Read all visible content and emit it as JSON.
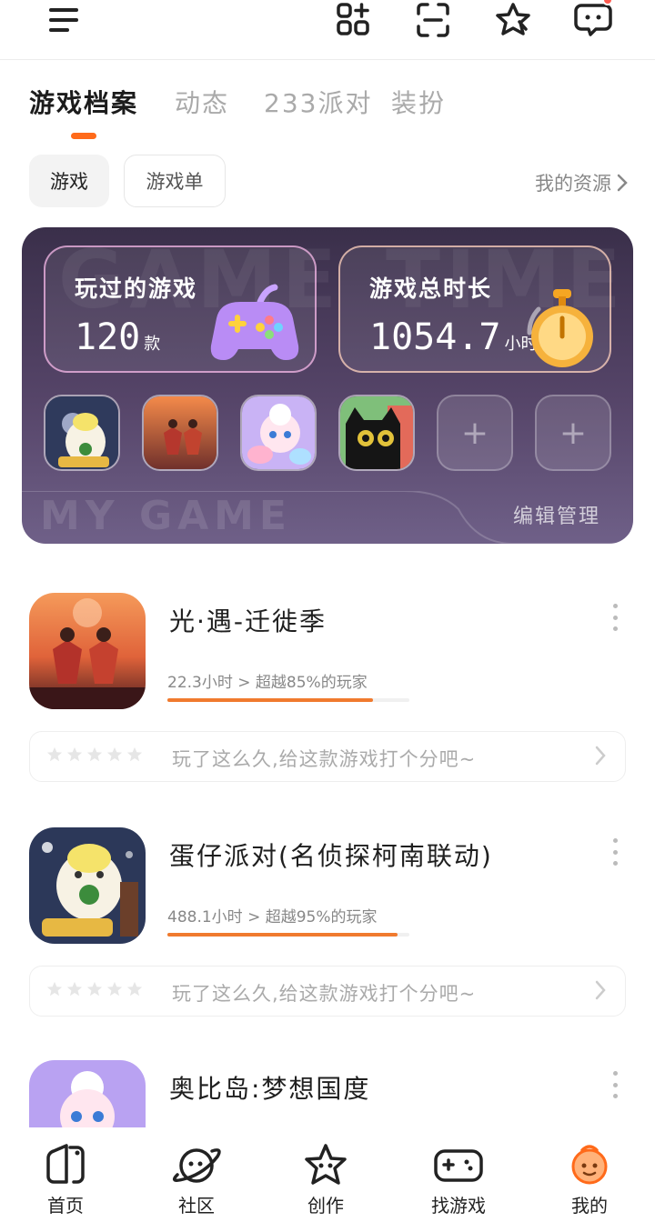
{
  "header": {
    "notification_badge": true
  },
  "tabs": [
    {
      "label": "游戏档案",
      "active": true
    },
    {
      "label": "动态",
      "active": false
    },
    {
      "label": "233派对",
      "active": false
    },
    {
      "label": "装扮",
      "active": false
    }
  ],
  "chips": {
    "game": "游戏",
    "list": "游戏单",
    "my_resources": "我的资源"
  },
  "card": {
    "bg_word_left": "GAME",
    "bg_word_right": "TIME",
    "bg_word_bottom": "MY GAME",
    "played": {
      "label": "玩过的游戏",
      "value": "120",
      "unit": "款"
    },
    "time": {
      "label": "游戏总时长",
      "value": "1054.7",
      "unit": "小时"
    },
    "edit_label": "编辑管理",
    "add_symbol": "+"
  },
  "games": [
    {
      "name": "光·遇-迁徙季",
      "stat": "22.3小时 > 超越85%的玩家",
      "progress": 0.85,
      "rate_prompt": "玩了这么久,给这款游戏打个分吧~"
    },
    {
      "name": "蛋仔派对(名侦探柯南联动)",
      "stat": "488.1小时 > 超越95%的玩家",
      "progress": 0.95,
      "rate_prompt": "玩了这么久,给这款游戏打个分吧~"
    },
    {
      "name": "奥比岛:梦想国度"
    }
  ],
  "nav": [
    {
      "label": "首页"
    },
    {
      "label": "社区"
    },
    {
      "label": "创作"
    },
    {
      "label": "找游戏"
    },
    {
      "label": "我的"
    }
  ],
  "colors": {
    "accent": "#ff6a1a",
    "card_bg": "#4a3d5c",
    "progress": "#f07a2e"
  }
}
